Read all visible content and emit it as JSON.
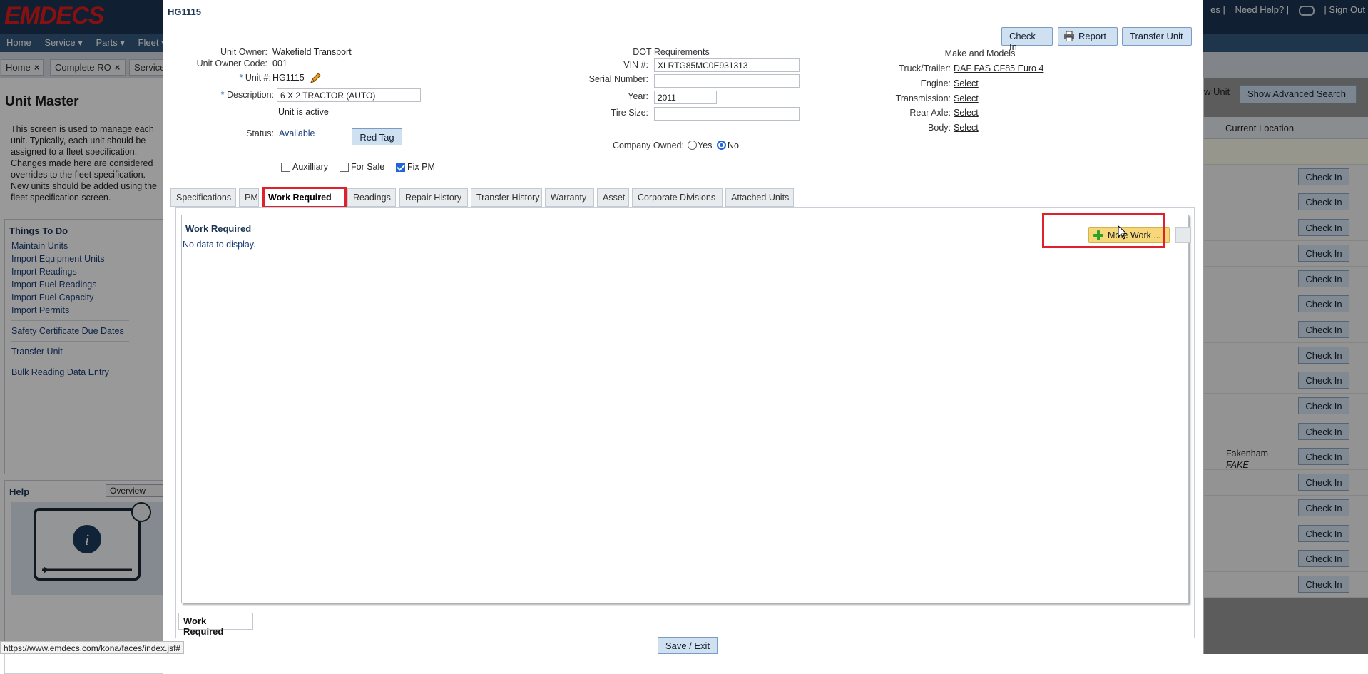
{
  "app": {
    "logo": "EMDECS",
    "top_links": [
      "es |",
      "Need Help? |",
      "| Sign Out"
    ],
    "nav": [
      "Home ",
      "Service ▾",
      "Parts ▾",
      "Fleet ▾"
    ],
    "tabs": [
      "Home",
      "Complete RO",
      "Service"
    ],
    "page_title": "Unit Master",
    "page_desc": "This screen is used to manage each unit. Typically, each unit should be assigned to a fleet specification. Changes made here are considered overrides to the fleet specification. New units should be added using the fleet specification screen.",
    "things_title": "Things To Do",
    "things": [
      "Maintain Units",
      "Import Equipment Units",
      "Import Readings",
      "Import Fuel Readings",
      "Import Fuel Capacity",
      "Import Permits",
      "Safety Certificate Due Dates",
      "Transfer Unit",
      "Bulk Reading Data Entry"
    ],
    "help_title": "Help",
    "help_select": "Overview",
    "new_unit_text": "w Unit",
    "advanced_search": "Show Advanced Search",
    "grid_header": "Current Location",
    "check_in_label": "Check In",
    "row_location_city": "Fakenham",
    "row_location_note": "FAKE",
    "status_url": "https://www.emdecs.com/kona/faces/index.jsf#"
  },
  "modal": {
    "title": "HG1115",
    "buttons": {
      "check_in": "Check In",
      "report": "Report",
      "transfer": "Transfer Unit"
    },
    "unit": {
      "owner_label": "Unit Owner:",
      "owner": "Wakefield Transport",
      "owner_code_label": "Unit Owner Code:",
      "owner_code": "001",
      "unit_label": "Unit #:",
      "unit": "HG1115",
      "desc_label": "Description:",
      "desc": "6 X 2 TRACTOR (AUTO)",
      "active": "Unit is active",
      "status_label": "Status:",
      "status": "Available",
      "red_tag": "Red Tag"
    },
    "checkboxes": {
      "auxiliary": "Auxilliary",
      "for_sale": "For Sale",
      "fix_pm": "Fix PM"
    },
    "dot": {
      "title": "DOT Requirements",
      "vin_label": "VIN #:",
      "vin": "XLRTG85MC0E931313",
      "serial_label": "Serial Number:",
      "serial": "",
      "year_label": "Year:",
      "year": "2011",
      "tire_label": "Tire Size:",
      "tire": "",
      "company_owned_label": "Company Owned:",
      "yes": "Yes",
      "no": "No"
    },
    "make": {
      "title": "Make and Models",
      "truck_label": "Truck/Trailer:",
      "truck": "DAF FAS CF85 Euro 4",
      "engine_label": "Engine:",
      "engine": "Select",
      "transmission_label": "Transmission:",
      "transmission": "Select",
      "rear_axle_label": "Rear Axle:",
      "rear_axle": "Select",
      "body_label": "Body:",
      "body": "Select"
    },
    "tabs": [
      "Specifications",
      "PM",
      "Work Required",
      "Readings",
      "Repair History",
      "Transfer History",
      "Warranty",
      "Asset",
      "Corporate Divisions",
      "Attached Units"
    ],
    "work_required": {
      "title": "Work Required",
      "no_data": "No data to display.",
      "more_work": "More Work ..."
    },
    "bottom_tab": "Work Required",
    "save_exit": "Save / Exit"
  }
}
